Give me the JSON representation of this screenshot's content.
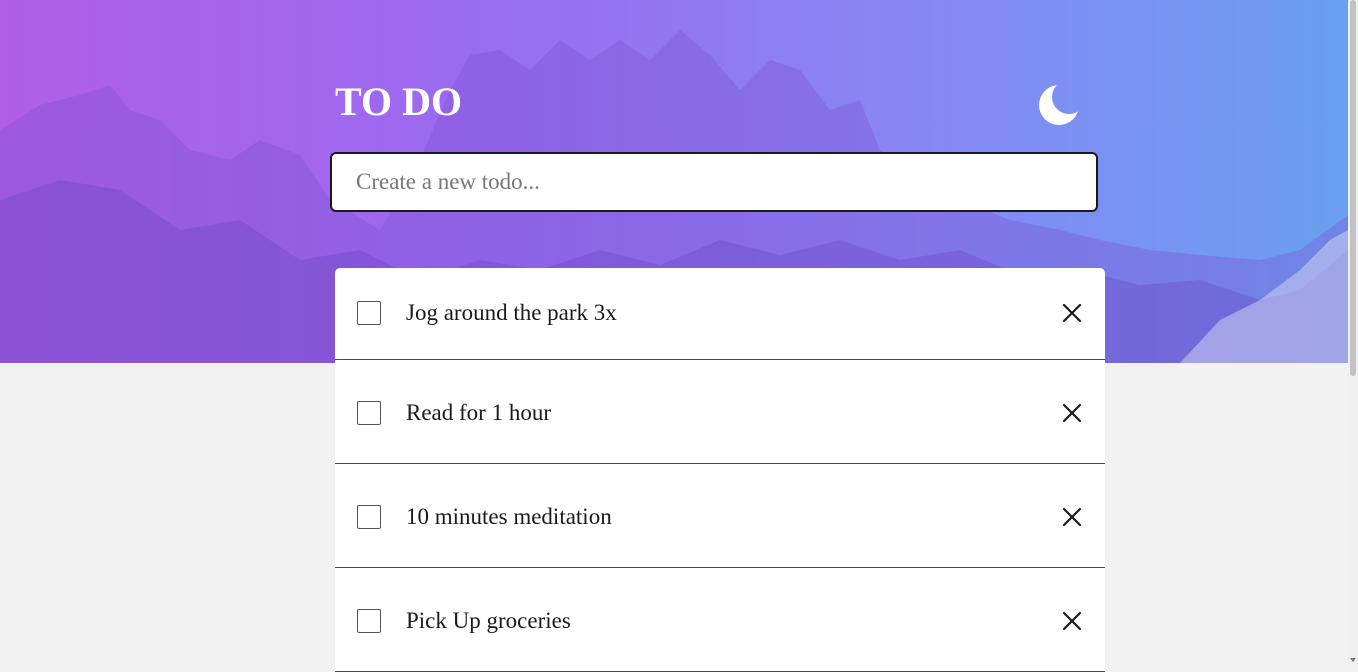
{
  "header": {
    "title": "TO DO",
    "theme_icon": "moon-icon"
  },
  "new_todo": {
    "placeholder": "Create a new todo...",
    "value": ""
  },
  "todos": [
    {
      "label": "Jog around the park 3x",
      "completed": false
    },
    {
      "label": "Read for 1 hour",
      "completed": false
    },
    {
      "label": "10 minutes meditation",
      "completed": false
    },
    {
      "label": "Pick Up groceries",
      "completed": false
    }
  ],
  "colors": {
    "gradient_start": "#b15ee8",
    "gradient_end": "#6aa0f0",
    "page_background": "#f2f2f2",
    "card_background": "#ffffff"
  }
}
